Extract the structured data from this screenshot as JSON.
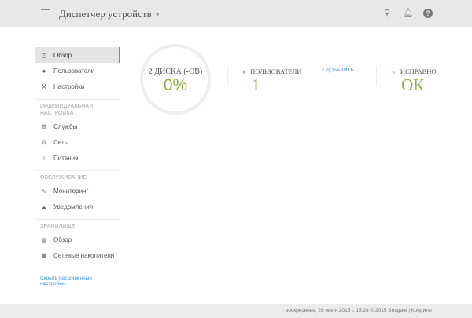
{
  "header": {
    "title": "Диспетчер устройств",
    "icons": [
      "menu-icon",
      "search-icon",
      "bell-icon",
      "help-icon"
    ]
  },
  "sidebar": {
    "main": [
      {
        "label": "Обзор",
        "icon": "dashboard-icon"
      },
      {
        "label": "Пользователи",
        "icon": "user-icon"
      },
      {
        "label": "Настройки",
        "icon": "wrench-icon"
      }
    ],
    "section1": "ИНДИВИДУАЛЬНАЯ НАСТРОЙКА",
    "custom": [
      {
        "label": "Службы",
        "icon": "gear-icon"
      },
      {
        "label": "Сеть",
        "icon": "network-icon"
      },
      {
        "label": "Питание",
        "icon": "bulb-icon"
      }
    ],
    "section2": "ОБСЛУЖИВАНИЕ",
    "maint": [
      {
        "label": "Мониторинг",
        "icon": "pulse-icon"
      },
      {
        "label": "Уведомления",
        "icon": "bell-icon"
      }
    ],
    "section3": "ХРАНИЛИЩЕ",
    "storage": [
      {
        "label": "Обзор",
        "icon": "storage-icon"
      },
      {
        "label": "Сетевые накопители",
        "icon": "nas-icon"
      }
    ],
    "hide_link": "Скрыть расширенные настройки..."
  },
  "main": {
    "disks_label": "2 ДИСКА (-ОВ)",
    "disks_value": "0%",
    "users_label": "ПОЛЬЗОВАТЕЛИ",
    "users_value": "1",
    "add_label": "+ ДОБАВИТЬ",
    "health_label": "ИСПРАВНО",
    "health_value": "ОК"
  },
  "footer": {
    "text": "воскресенье, 26 июля 2015 г.   15:28   © 2015 Seagate | Кредиты"
  },
  "colors": {
    "accent": "#3aa0d8",
    "value": "#8bb444"
  }
}
